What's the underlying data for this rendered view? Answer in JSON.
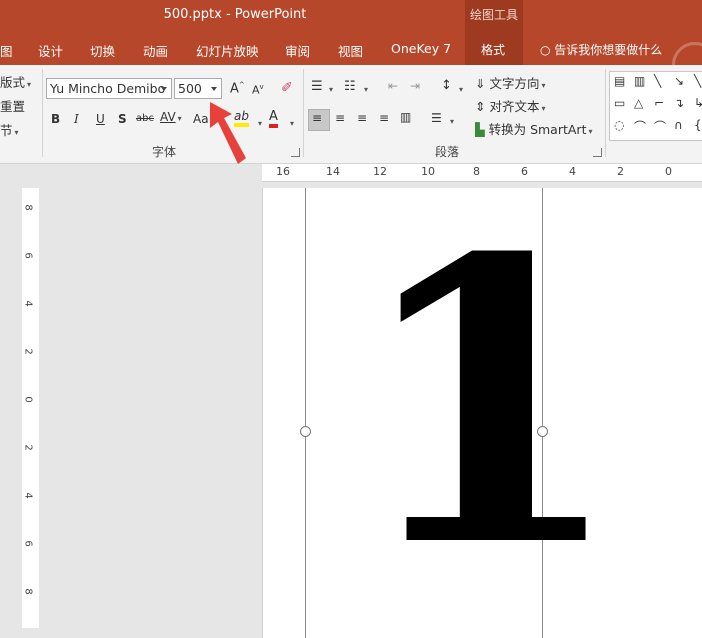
{
  "titlebar": {
    "title": "500.pptx  -  PowerPoint",
    "context_group": "绘图工具"
  },
  "tabs": [
    {
      "label": "图"
    },
    {
      "label": "设计"
    },
    {
      "label": "切换"
    },
    {
      "label": "动画"
    },
    {
      "label": "幻灯片放映"
    },
    {
      "label": "审阅"
    },
    {
      "label": "视图"
    },
    {
      "label": "OneKey 7"
    },
    {
      "label": "格式"
    }
  ],
  "tellme": "告诉我你想要做什么",
  "slides_group": {
    "layout": "版式",
    "reset": "重置",
    "section": "节"
  },
  "font_group": {
    "font_name": "Yu Mincho Demibo",
    "font_size": "500",
    "label": "字体",
    "bold": "B",
    "italic": "I",
    "underline": "U",
    "shadow": "S",
    "strike": "abc",
    "spacing": "AV",
    "case": "Aa",
    "highlight": "ab",
    "color": "A",
    "grow": "A",
    "shrink": "A"
  },
  "paragraph_group": {
    "label": "段落",
    "text_direction": "文字方向",
    "align_text": "对齐文本",
    "smartart": "转换为 SmartArt"
  },
  "ruler": {
    "h_labels": [
      "16",
      "14",
      "12",
      "10",
      "8",
      "6",
      "4",
      "2",
      "0"
    ],
    "v_labels": [
      "8",
      "6",
      "4",
      "2",
      "0",
      "2",
      "4",
      "6",
      "8"
    ]
  },
  "slide": {
    "text": "1"
  },
  "colors": {
    "accent": "#b7472a",
    "accent_dark": "#9e3a20",
    "arrow": "#e8403a"
  }
}
